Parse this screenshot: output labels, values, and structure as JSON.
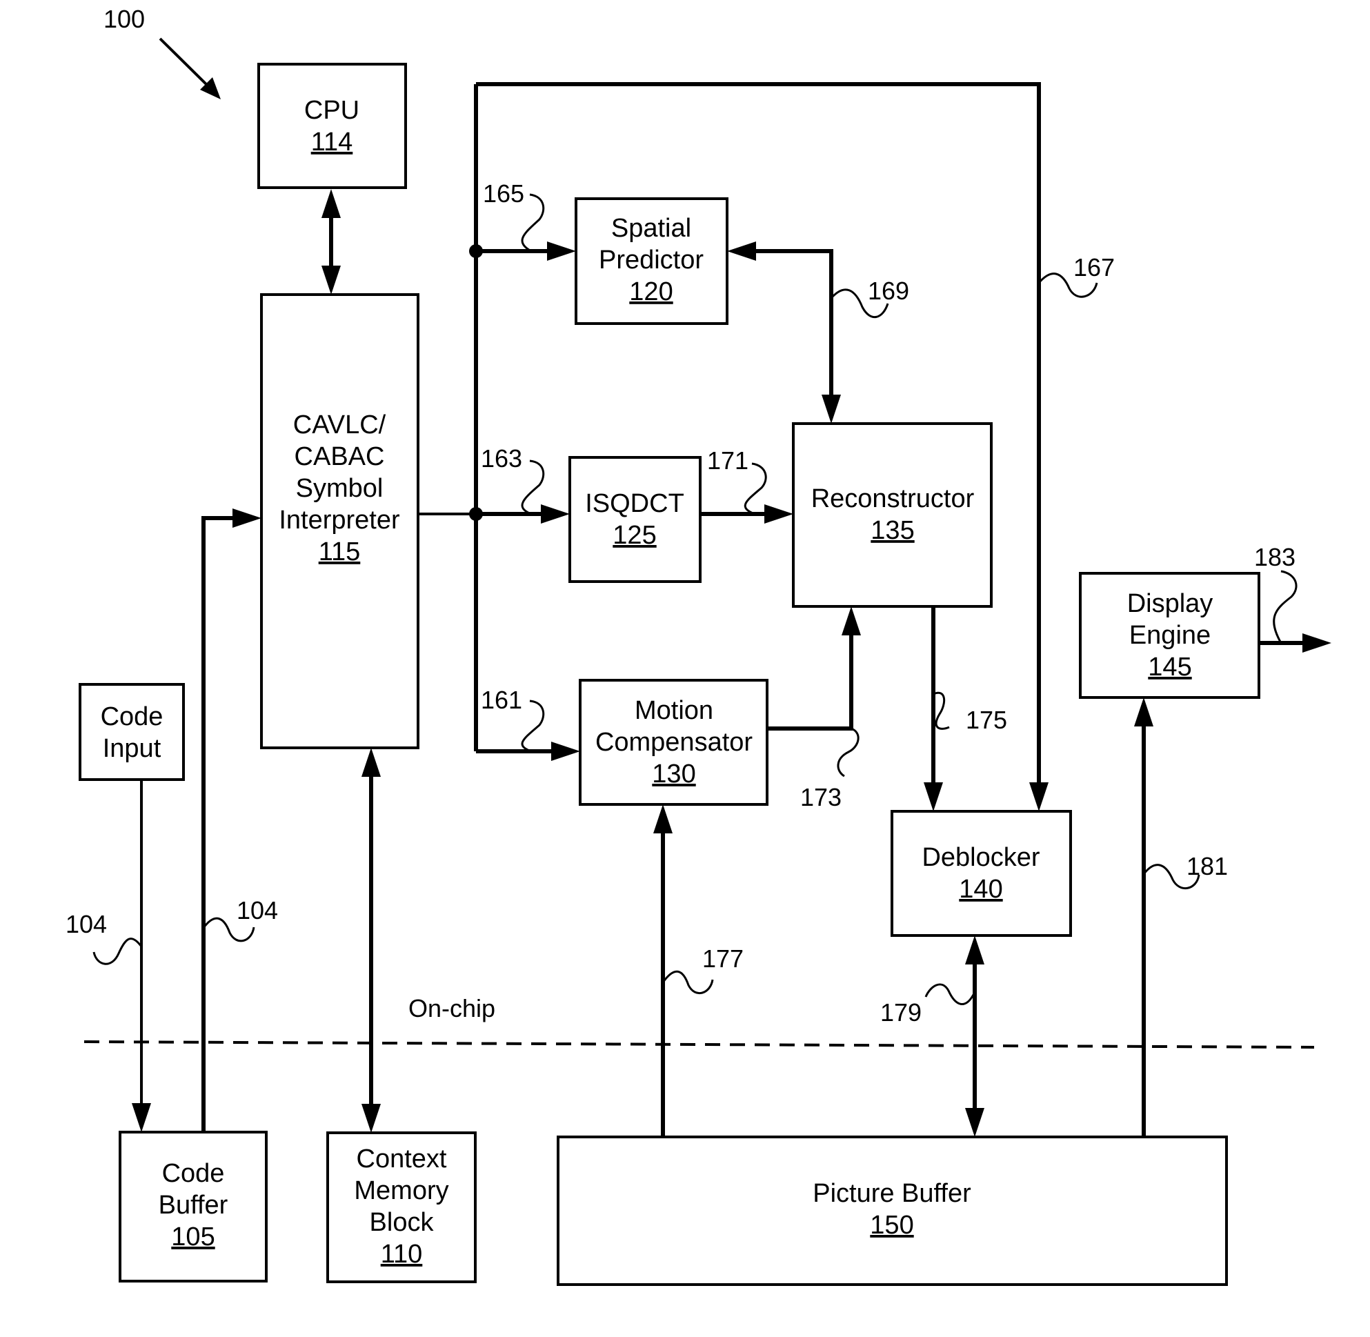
{
  "figure": {
    "reference": "100",
    "region_label": "On-chip"
  },
  "blocks": {
    "cpu": {
      "lines": [
        "CPU"
      ],
      "number": "114"
    },
    "interpreter": {
      "lines": [
        "CAVLC/",
        "CABAC",
        "Symbol",
        "Interpreter"
      ],
      "number": "115"
    },
    "spatial_predictor": {
      "lines": [
        "Spatial",
        "Predictor"
      ],
      "number": "120"
    },
    "isqdct": {
      "lines": [
        "ISQDCT"
      ],
      "number": "125"
    },
    "motion_compensator": {
      "lines": [
        "Motion",
        "Compensator"
      ],
      "number": "130"
    },
    "reconstructor": {
      "lines": [
        "Reconstructor"
      ],
      "number": "135"
    },
    "deblocker": {
      "lines": [
        "Deblocker"
      ],
      "number": "140"
    },
    "display_engine": {
      "lines": [
        "Display",
        "Engine"
      ],
      "number": "145"
    },
    "picture_buffer": {
      "lines": [
        "Picture Buffer"
      ],
      "number": "150"
    },
    "code_input": {
      "lines": [
        "Code",
        "Input"
      ]
    },
    "code_buffer": {
      "lines": [
        "Code",
        "Buffer"
      ],
      "number": "105"
    },
    "context_memory": {
      "lines": [
        "Context",
        "Memory",
        "Block"
      ],
      "number": "110"
    }
  },
  "connections": {
    "c104a": "104",
    "c104b": "104",
    "c161": "161",
    "c163": "163",
    "c165": "165",
    "c167": "167",
    "c169": "169",
    "c171": "171",
    "c173": "173",
    "c175": "175",
    "c177": "177",
    "c179": "179",
    "c181": "181",
    "c183": "183"
  }
}
